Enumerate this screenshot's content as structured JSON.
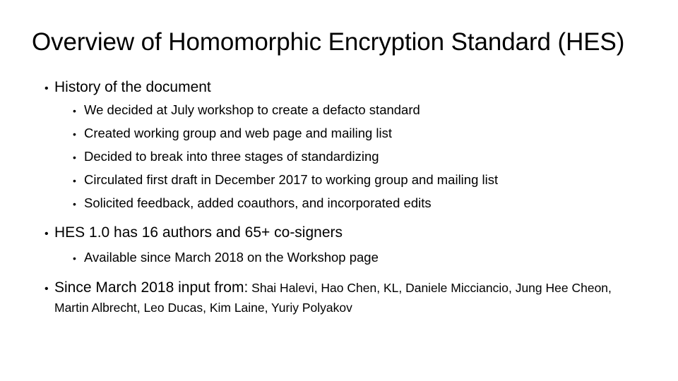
{
  "slide": {
    "title": "Overview of Homomorphic Encryption Standard (HES)",
    "background_color": "#ffffff",
    "text_color": "#000000",
    "bullet_glyph": "•",
    "sections": [
      {
        "heading": "History of the document",
        "sub_items": [
          "We decided at July workshop to create a defacto standard",
          "Created working group and web page and mailing list",
          "Decided to break into three stages of standardizing",
          "Circulated first draft in December 2017 to working group and mailing list",
          "Solicited feedback, added coauthors, and incorporated edits"
        ]
      },
      {
        "heading": "HES 1.0 has 16 authors and 65+ co-signers",
        "sub_items": [
          "Available since March 2018 on the Workshop page"
        ]
      }
    ],
    "contributors_block": {
      "lead": "Since March 2018 input from:",
      "names": " Shai Halevi, Hao Chen, KL, Daniele Micciancio, Jung Hee Cheon, Martin Albrecht, Leo Ducas, Kim Laine, Yuriy Polyakov"
    }
  }
}
